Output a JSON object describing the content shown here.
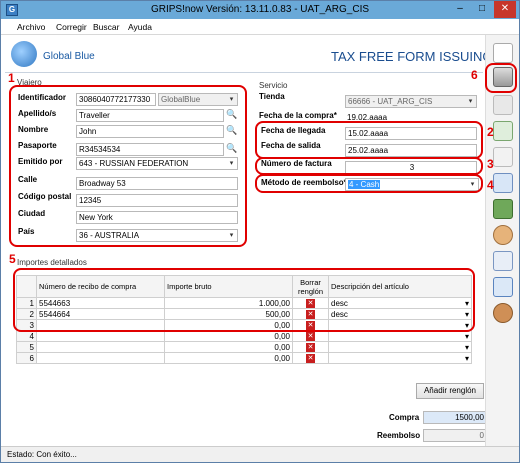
{
  "window": {
    "title": "GRIPS!now Versión: 13.11.0.83 - UAT_ARG_CIS"
  },
  "menu": [
    "Archivo",
    "Corregir",
    "Buscar",
    "Ayuda"
  ],
  "brand": {
    "name": "Global Blue",
    "header": "TAX FREE FORM ISSUING"
  },
  "viajero": {
    "section": "Viajero",
    "identificador_label": "Identificador",
    "identificador": "3086040772177330",
    "identificador_type": "GlobalBlue",
    "apellido_label": "Apellido/s",
    "apellido": "Traveller",
    "nombre_label": "Nombre",
    "nombre": "John",
    "pasaporte_label": "Pasaporte",
    "pasaporte": "R34534534",
    "emitido_label": "Emitido por",
    "emitido": "643 - RUSSIAN FEDERATION",
    "calle_label": "Calle",
    "calle": "Broadway 53",
    "cp_label": "Código postal",
    "cp": "12345",
    "ciudad_label": "Ciudad",
    "ciudad": "New York",
    "pais_label": "País",
    "pais": "36 - AUSTRALIA"
  },
  "servicio": {
    "section": "Servicio",
    "tienda_label": "Tienda",
    "tienda": "66666 - UAT_ARG_CIS",
    "fecha_compra_label": "Fecha de la compra*",
    "fecha_compra": "19.02.aaaa",
    "fecha_llegada_label": "Fecha de llegada",
    "fecha_llegada": "15.02.aaaa",
    "fecha_salida_label": "Fecha de salida",
    "fecha_salida": "25.02.aaaa",
    "factura_label": "Número de factura",
    "factura": "3",
    "metodo_label": "Método de reembolso*",
    "metodo": "4 - Cash"
  },
  "importes": {
    "section": "Importes detallados",
    "headers": [
      "Número de recibo de compra",
      "Importe bruto",
      "Borrar renglón",
      "Descripción del artículo"
    ],
    "rows": [
      {
        "n": "1",
        "recibo": "5544663",
        "importe": "1.000,00",
        "desc": "desc"
      },
      {
        "n": "2",
        "recibo": "5544664",
        "importe": "500,00",
        "desc": "desc"
      },
      {
        "n": "3",
        "recibo": "",
        "importe": "0,00",
        "desc": ""
      },
      {
        "n": "4",
        "recibo": "",
        "importe": "0,00",
        "desc": ""
      },
      {
        "n": "5",
        "recibo": "",
        "importe": "0,00",
        "desc": ""
      },
      {
        "n": "6",
        "recibo": "",
        "importe": "0,00",
        "desc": ""
      }
    ],
    "add_button": "Añadir renglón"
  },
  "totals": {
    "compra_label": "Compra",
    "compra": "1500,00",
    "reembolso_label": "Reembolso",
    "reembolso": "0"
  },
  "status": {
    "text": "Estado:  Con éxito..."
  },
  "annotations": [
    "1",
    "2",
    "3",
    "4",
    "5",
    "6"
  ]
}
